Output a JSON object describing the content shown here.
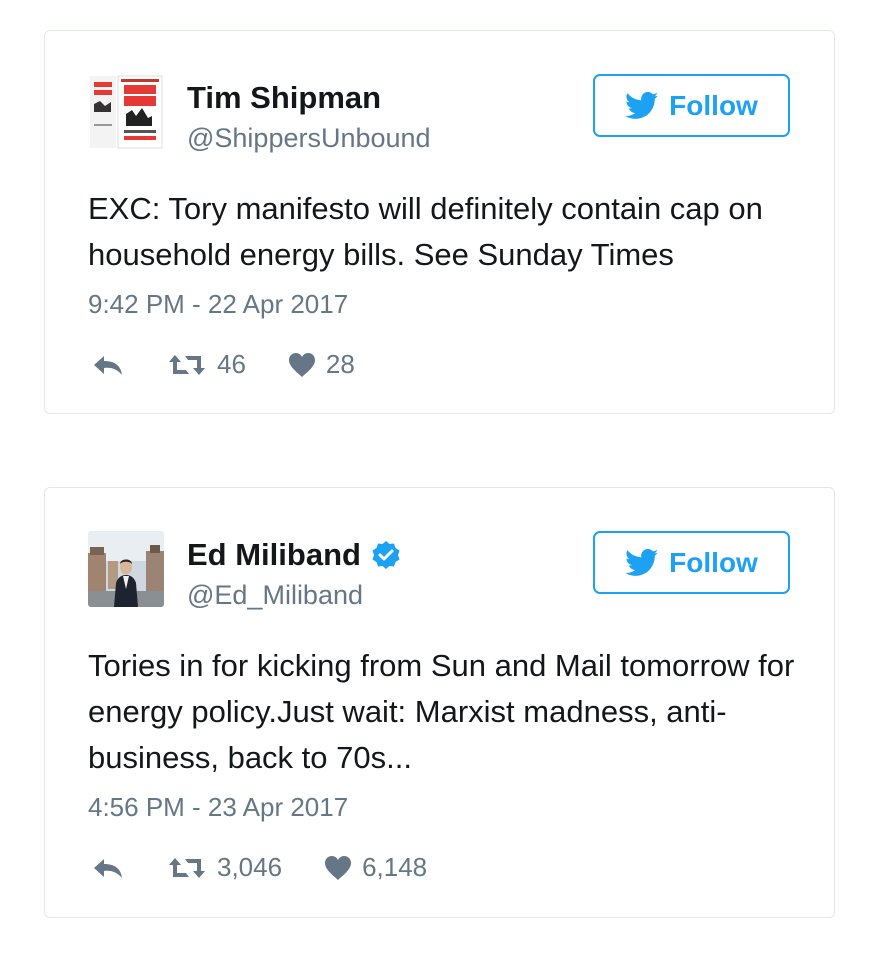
{
  "tweets": [
    {
      "display_name": "Tim Shipman",
      "handle": "@ShippersUnbound",
      "verified": false,
      "avatar_icon": "book-cover-all-out-war",
      "follow_label": "Follow",
      "text": "EXC: Tory manifesto will definitely contain cap on household energy bills. See Sunday Times",
      "timestamp": "9:42 PM - 22 Apr 2017",
      "retweets": "46",
      "likes": "28"
    },
    {
      "display_name": "Ed Miliband",
      "handle": "@Ed_Miliband",
      "verified": true,
      "avatar_icon": "profile-photo",
      "follow_label": "Follow",
      "text": "Tories in for kicking from Sun and Mail tomorrow for energy policy.Just wait: Marxist madness, anti-business, back to 70s...",
      "timestamp": "4:56 PM - 23 Apr 2017",
      "retweets": "3,046",
      "likes": "6,148"
    }
  ],
  "colors": {
    "accent": "#1da1f2",
    "text": "#14171a",
    "muted": "#657786",
    "border": "#e1e8ed",
    "verified": "#1da1f2"
  }
}
